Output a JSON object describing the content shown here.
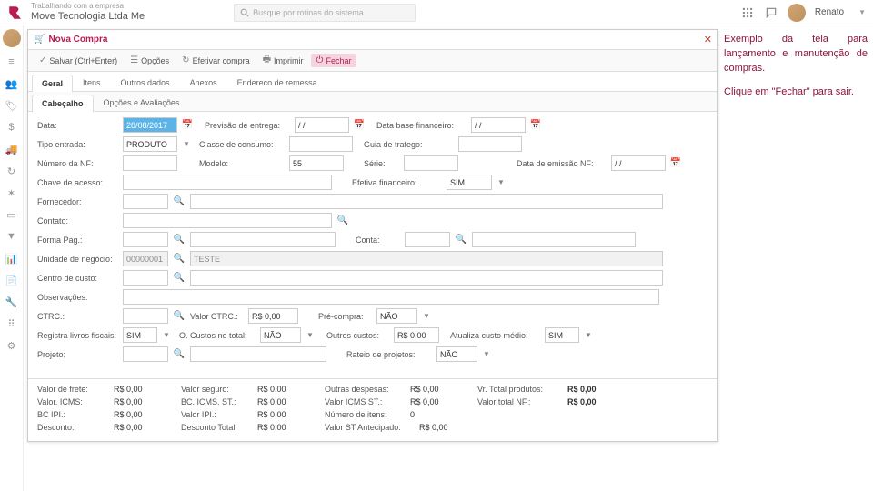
{
  "top": {
    "company_label": "Trabalhando com a empresa",
    "company_name": "Move Tecnologia Ltda Me",
    "search_placeholder": "Busque por rotinas do sistema",
    "user_name": "Renato"
  },
  "window": {
    "title": "Nova Compra",
    "toolbar": {
      "salvar": "Salvar (Ctrl+Enter)",
      "opcoes": "Opções",
      "efetivar": "Efetivar compra",
      "imprimir": "Imprimir",
      "fechar": "Fechar"
    },
    "tabs": [
      "Geral",
      "Itens",
      "Outros dados",
      "Anexos",
      "Endereco de remessa"
    ],
    "subtabs": [
      "Cabeçalho",
      "Opções e Avaliações"
    ]
  },
  "form": {
    "data_lbl": "Data:",
    "data_val": "28/08/2017",
    "prev_lbl": "Previsão de entrega:",
    "prev_val": "/ /",
    "dbf_lbl": "Data base financeiro:",
    "dbf_val": "/ /",
    "tipo_lbl": "Tipo entrada:",
    "tipo_val": "PRODUTO",
    "classe_lbl": "Classe de consumo:",
    "guia_lbl": "Guia de trafego:",
    "nnf_lbl": "Número da NF:",
    "modelo_lbl": "Modelo:",
    "modelo_val": "55",
    "serie_lbl": "Série:",
    "denf_lbl": "Data de emissão NF:",
    "denf_val": "/ /",
    "chave_lbl": "Chave de acesso:",
    "efetiva_lbl": "Efetiva financeiro:",
    "efetiva_val": "SIM",
    "forn_lbl": "Fornecedor:",
    "contato_lbl": "Contato:",
    "forma_lbl": "Forma Pag.:",
    "conta_lbl": "Conta:",
    "un_lbl": "Unidade de negócio:",
    "un_code": "00000001",
    "un_name": "TESTE",
    "cc_lbl": "Centro de custo:",
    "obs_lbl": "Observações:",
    "ctrc_lbl": "CTRC.:",
    "vctrc_lbl": "Valor CTRC.:",
    "vctrc_val": "R$ 0,00",
    "pre_lbl": "Pré-compra:",
    "pre_val": "NÃO",
    "rlf_lbl": "Registra livros fiscais:",
    "rlf_val": "SIM",
    "oct_lbl": "O. Custos no total:",
    "oct_val": "NÃO",
    "ocustos_lbl": "Outros custos:",
    "ocustos_val": "R$ 0,00",
    "acm_lbl": "Atualiza custo médio:",
    "acm_val": "SIM",
    "proj_lbl": "Projeto:",
    "rateio_lbl": "Rateio de projetos:",
    "rateio_val": "NÃO"
  },
  "totals": {
    "frete_lbl": "Valor de frete:",
    "frete": "R$ 0,00",
    "seguro_lbl": "Valor seguro:",
    "seguro": "R$ 0,00",
    "outras_lbl": "Outras despesas:",
    "outras": "R$ 0,00",
    "vtp_lbl": "Vr. Total produtos:",
    "vtp": "R$ 0,00",
    "vicms_lbl": "Valor. ICMS:",
    "vicms": "R$ 0,00",
    "bcicmsst_lbl": "BC. ICMS. ST.:",
    "bcicmsst": "R$ 0,00",
    "vicmsst_lbl": "Valor ICMS ST.:",
    "vicmsst": "R$ 0,00",
    "vtnf_lbl": "Valor total NF.:",
    "vtnf": "R$ 0,00",
    "bcipi_lbl": "BC IPI.:",
    "bcipi": "R$ 0,00",
    "vipi_lbl": "Valor IPI.:",
    "vipi": "R$ 0,00",
    "nitens_lbl": "Número de itens:",
    "nitens": "0",
    "desc_lbl": "Desconto:",
    "desc": "R$ 0,00",
    "desct_lbl": "Desconto Total:",
    "desct": "R$ 0,00",
    "vstant_lbl": "Valor ST Antecipado:",
    "vstant": "R$ 0,00"
  },
  "annotation": {
    "p1": "Exemplo da tela para lançamento e manutenção de compras.",
    "p2": "Clique em \"Fechar\" para sair."
  }
}
